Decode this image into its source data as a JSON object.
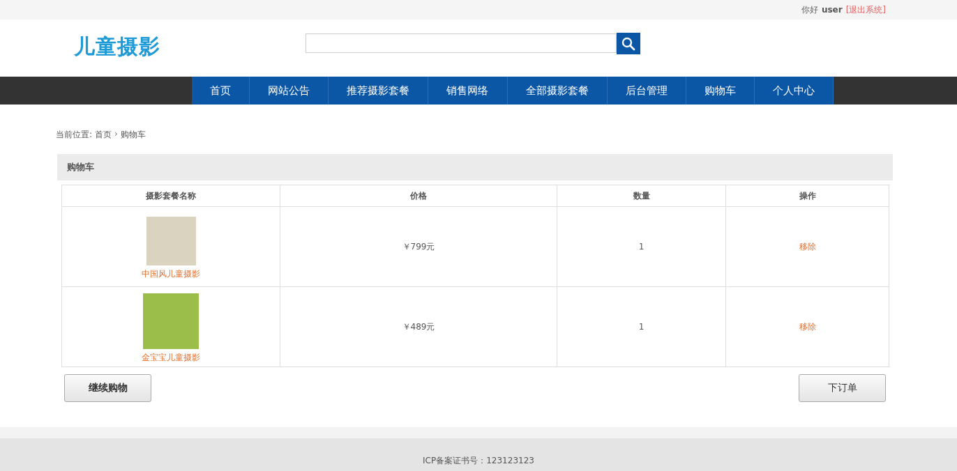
{
  "top_bar": {
    "greeting": "你好",
    "username": "user",
    "logout": "[退出系统]"
  },
  "header": {
    "logo": "儿童摄影"
  },
  "nav": [
    {
      "label": "首页"
    },
    {
      "label": "网站公告"
    },
    {
      "label": "推荐摄影套餐"
    },
    {
      "label": "销售网络"
    },
    {
      "label": "全部摄影套餐"
    },
    {
      "label": "后台管理"
    },
    {
      "label": "购物车"
    },
    {
      "label": "个人中心"
    }
  ],
  "breadcrumb": {
    "prefix": "当前位置:",
    "separator": "›",
    "items": [
      "首页",
      "购物车"
    ]
  },
  "cart": {
    "title": "购物车",
    "columns": [
      "摄影套餐名称",
      "价格",
      "数量",
      "操作"
    ],
    "rows": [
      {
        "name": "中国风儿童摄影",
        "price": "￥799元",
        "quantity": "1",
        "action": "移除"
      },
      {
        "name": "金宝宝儿童摄影",
        "price": "￥489元",
        "quantity": "1",
        "action": "移除"
      }
    ]
  },
  "buttons": {
    "continue": "继续购物",
    "order": "下订单"
  },
  "footer": {
    "icp": "ICP备案证书号：123123123"
  }
}
